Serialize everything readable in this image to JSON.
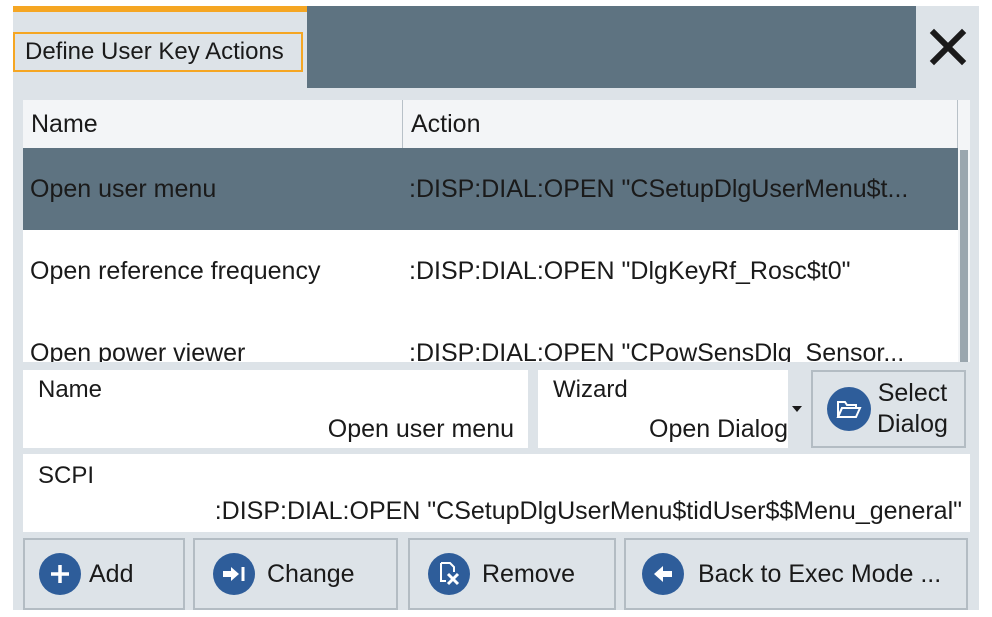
{
  "dialog": {
    "title": "Define User Key Actions",
    "close_icon": "close-icon"
  },
  "table": {
    "columns": [
      "Name",
      "Action"
    ],
    "rows": [
      {
        "name": "Open user menu",
        "action": ":DISP:DIAL:OPEN \"CSetupDlgUserMenu$t..."
      },
      {
        "name": "Open reference frequency",
        "action": ":DISP:DIAL:OPEN \"DlgKeyRf_Rosc$t0\""
      },
      {
        "name": "Open power viewer",
        "action": ":DISP:DIAL:OPEN \"CPowSensDlg_Sensor..."
      }
    ]
  },
  "form": {
    "name_label": "Name",
    "name_value": "Open user menu",
    "wizard_label": "Wizard",
    "wizard_value": "Open Dialog",
    "select_dialog_line1": "Select",
    "select_dialog_line2": "Dialog",
    "scpi_label": "SCPI",
    "scpi_value": ":DISP:DIAL:OPEN \"CSetupDlgUserMenu$tidUser$$Menu_general\""
  },
  "buttons": {
    "add": "Add",
    "change": "Change",
    "remove": "Remove",
    "back": "Back to Exec Mode ..."
  },
  "colors": {
    "accent": "#f5a623",
    "header": "#5e7381",
    "icon_blue": "#2e5d9a"
  }
}
